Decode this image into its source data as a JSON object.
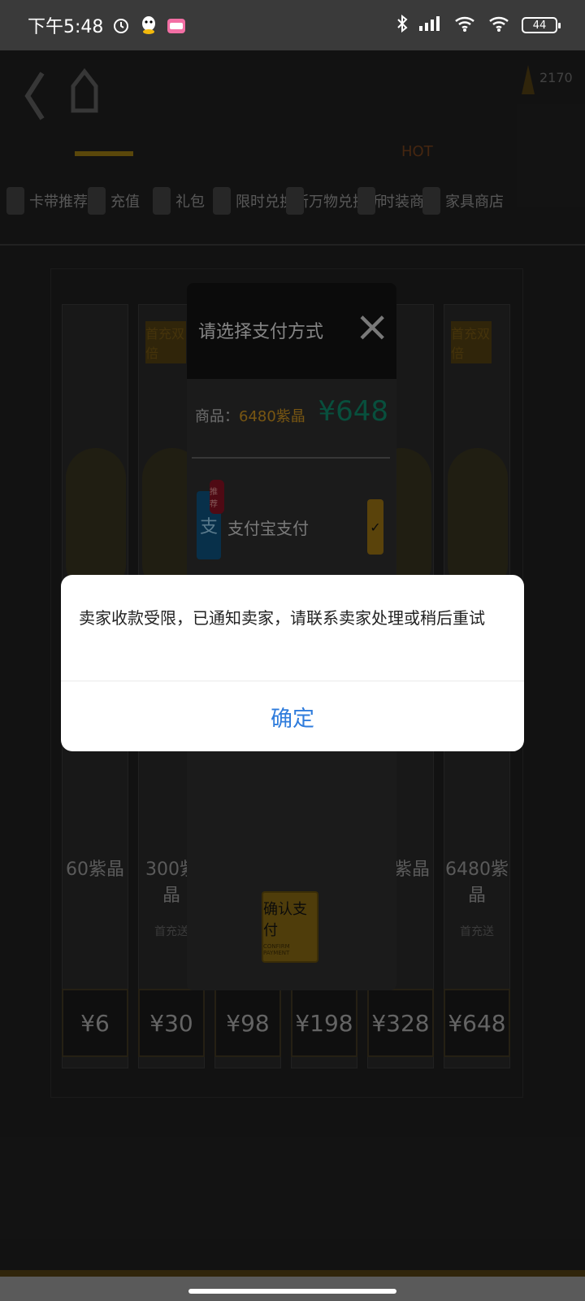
{
  "status_bar": {
    "time": "下午5:48",
    "battery": "44"
  },
  "game": {
    "coin_value": "2170",
    "tabs": [
      "卡带推荐",
      "充值",
      "礼包",
      "限时兑换所",
      "万物兑换所",
      "时装商店",
      "家具商店"
    ],
    "hot_badge": "HOT",
    "cards": [
      {
        "name": "60紫晶",
        "price": "¥6",
        "first": ""
      },
      {
        "name": "300紫晶",
        "price": "¥30",
        "first": "首充双倍"
      },
      {
        "name": "",
        "price": "¥98",
        "first": ""
      },
      {
        "name": "",
        "price": "¥198",
        "first": ""
      },
      {
        "name": "30紫晶",
        "price": "¥328",
        "first": ""
      },
      {
        "name": "6480紫晶",
        "price": "¥648",
        "first": "首充双倍"
      }
    ],
    "extra_text": "首充送"
  },
  "payment": {
    "title": "请选择支付方式",
    "close_icon": "close-icon",
    "product_label": "商品：",
    "product_name": "6480紫晶",
    "amount": "¥648",
    "method_label": "支付宝支付",
    "method_badge": "推荐",
    "alipay_glyph": "支",
    "confirm_label": "确认支付",
    "confirm_sub": "CONFIRM PAYMENT"
  },
  "dialog": {
    "message": "卖家收款受限，已通知卖家，请联系卖家处理或稍后重试",
    "ok_label": "确定"
  },
  "colors": {
    "dialog_button": "#2f7cdc",
    "amount": "#0d7a5e",
    "gold": "#b8841c"
  }
}
